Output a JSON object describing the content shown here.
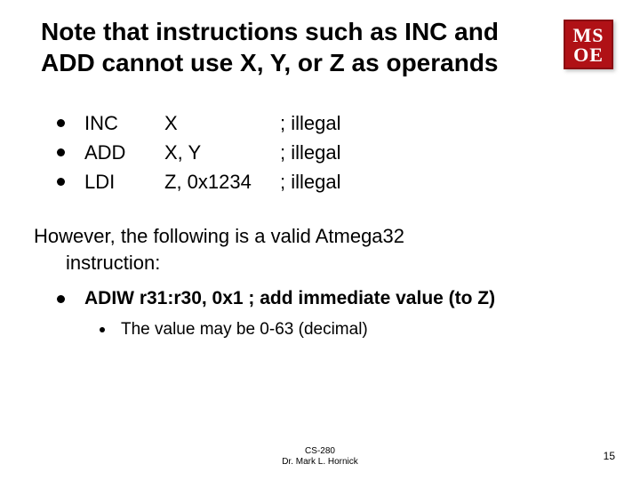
{
  "logo": {
    "line1": "MS",
    "line2": "OE"
  },
  "title": "Note that instructions such as INC and ADD cannot use X, Y, or Z as operands",
  "illegal": [
    {
      "instr": "INC",
      "arg": "X",
      "cmt": "; illegal"
    },
    {
      "instr": "ADD",
      "arg": "X, Y",
      "cmt": "; illegal"
    },
    {
      "instr": "LDI",
      "arg": "Z, 0x1234",
      "cmt": "; illegal"
    }
  ],
  "however_line1": "However, the following is a valid Atmega32",
  "however_line2": "instruction:",
  "adiw": "ADIW r31:r30, 0x1 ; add immediate value (to Z)",
  "subnote": "The value may be 0-63 (decimal)",
  "footer1": "CS-280",
  "footer2": "Dr. Mark L. Hornick",
  "pagenum": "15"
}
